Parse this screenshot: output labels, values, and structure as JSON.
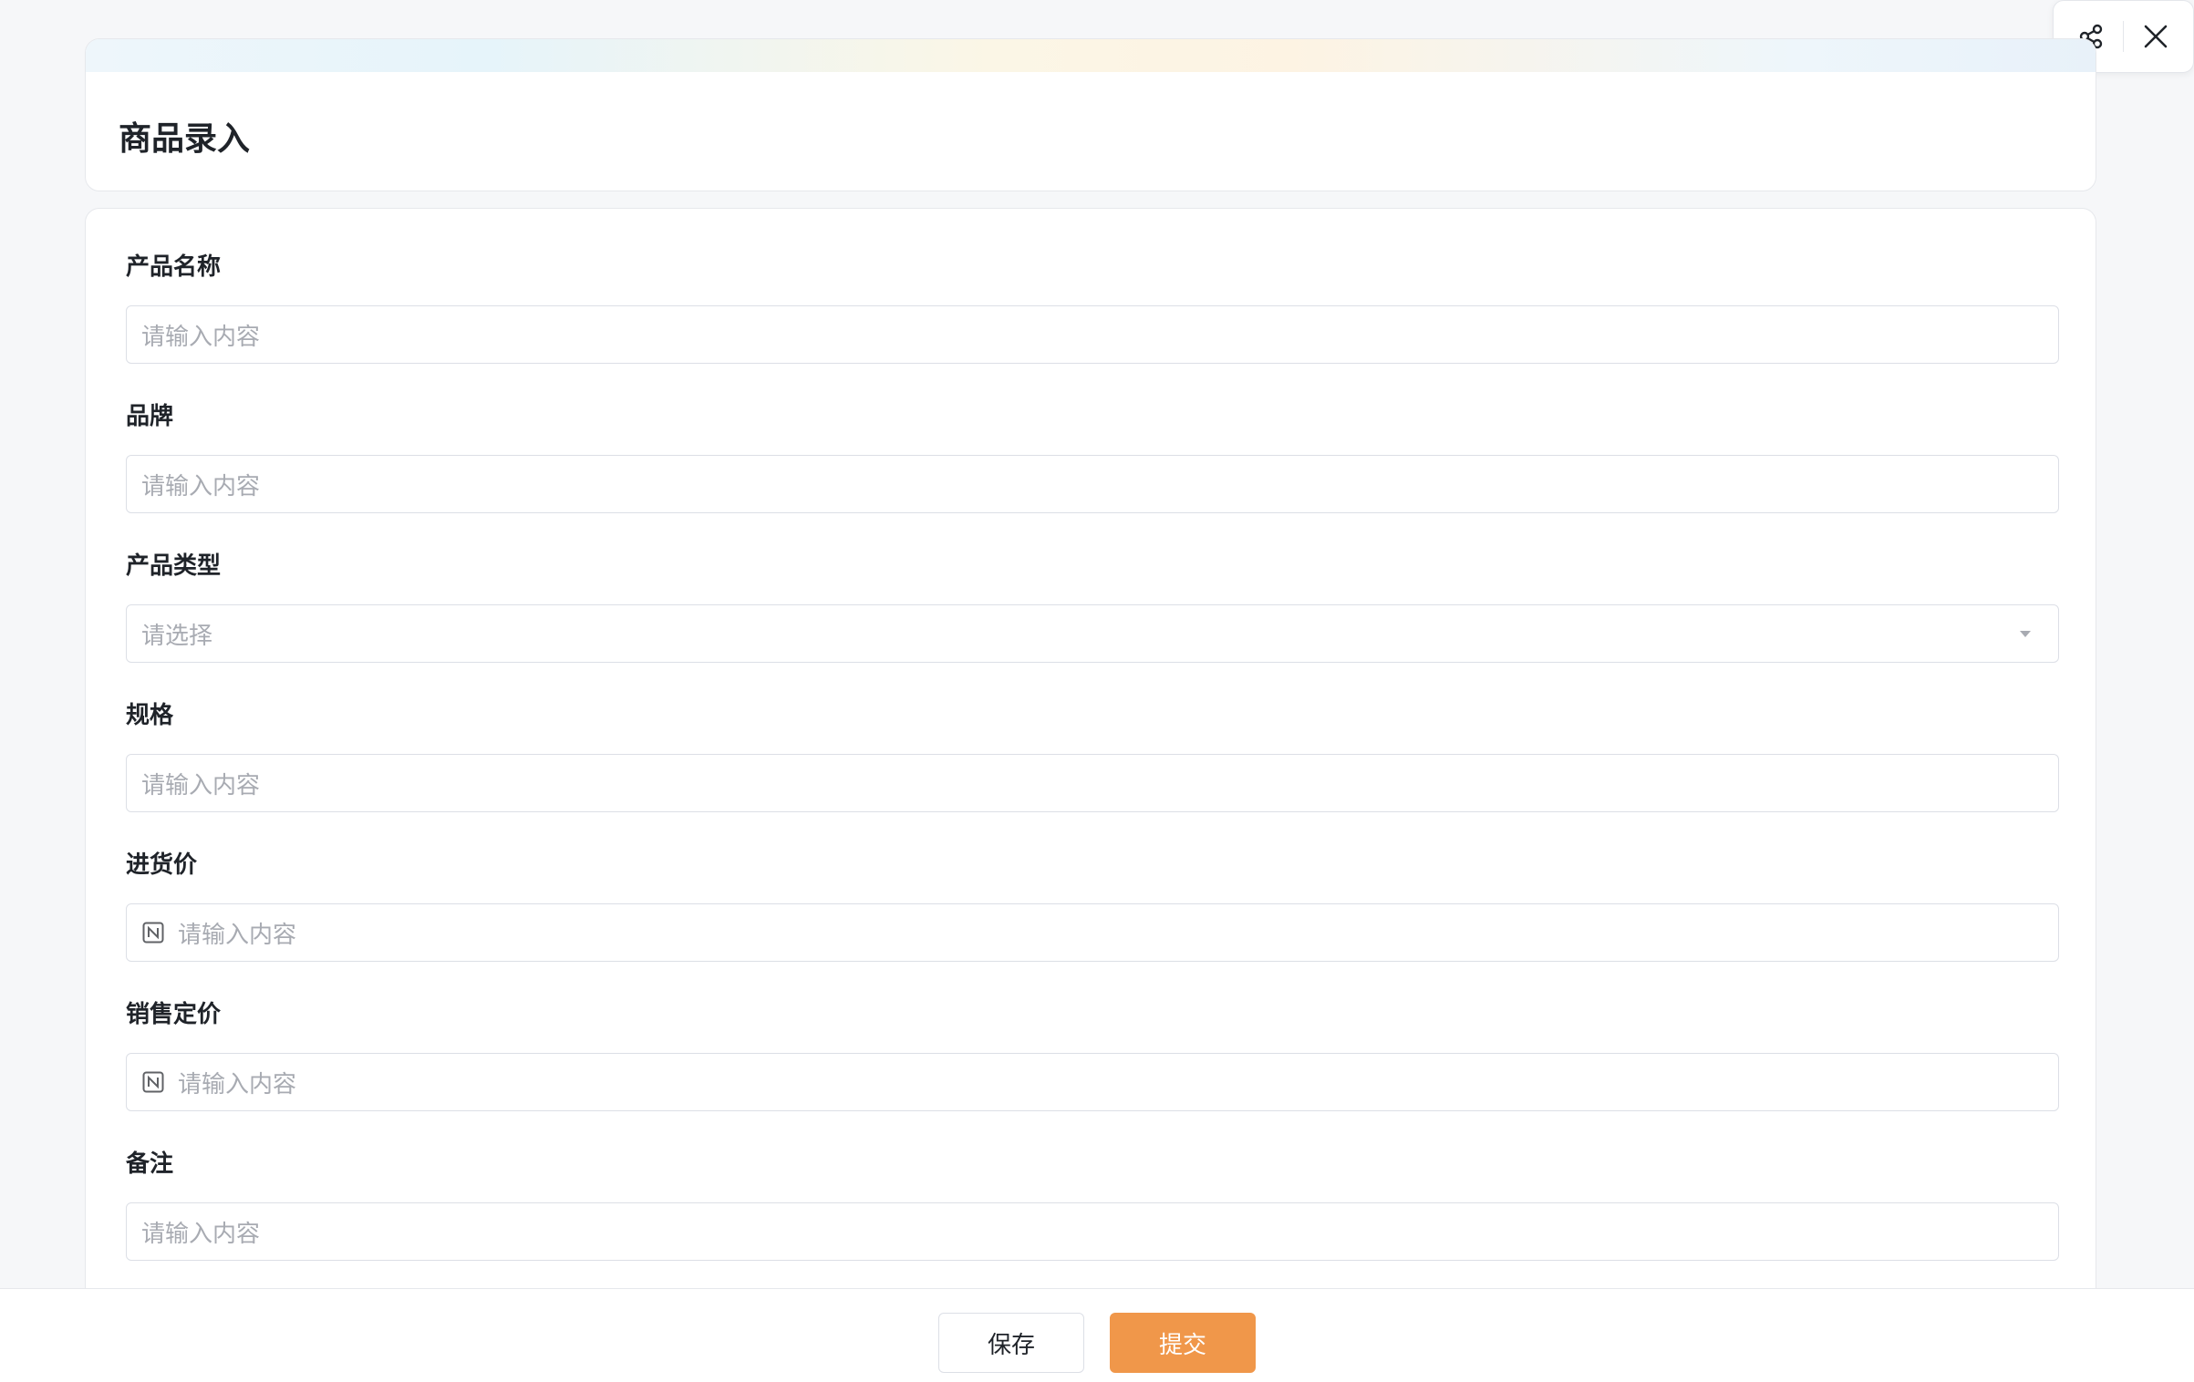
{
  "header": {
    "title": "商品录入"
  },
  "toolbar": {
    "share_icon": "share-icon",
    "close_icon": "close-icon"
  },
  "form": {
    "fields": [
      {
        "label": "产品名称",
        "type": "text",
        "placeholder": "请输入内容",
        "value": ""
      },
      {
        "label": "品牌",
        "type": "text",
        "placeholder": "请输入内容",
        "value": ""
      },
      {
        "label": "产品类型",
        "type": "select",
        "placeholder": "请选择",
        "value": ""
      },
      {
        "label": "规格",
        "type": "text",
        "placeholder": "请输入内容",
        "value": ""
      },
      {
        "label": "进货价",
        "type": "number",
        "placeholder": "请输入内容",
        "value": ""
      },
      {
        "label": "销售定价",
        "type": "number",
        "placeholder": "请输入内容",
        "value": ""
      },
      {
        "label": "备注",
        "type": "text",
        "placeholder": "请输入内容",
        "value": ""
      }
    ]
  },
  "footer": {
    "save_label": "保存",
    "submit_label": "提交"
  },
  "colors": {
    "accent": "#f0974a",
    "border": "#dcdfe6",
    "placeholder": "#a8abb2",
    "background": "#f6f7f9"
  }
}
